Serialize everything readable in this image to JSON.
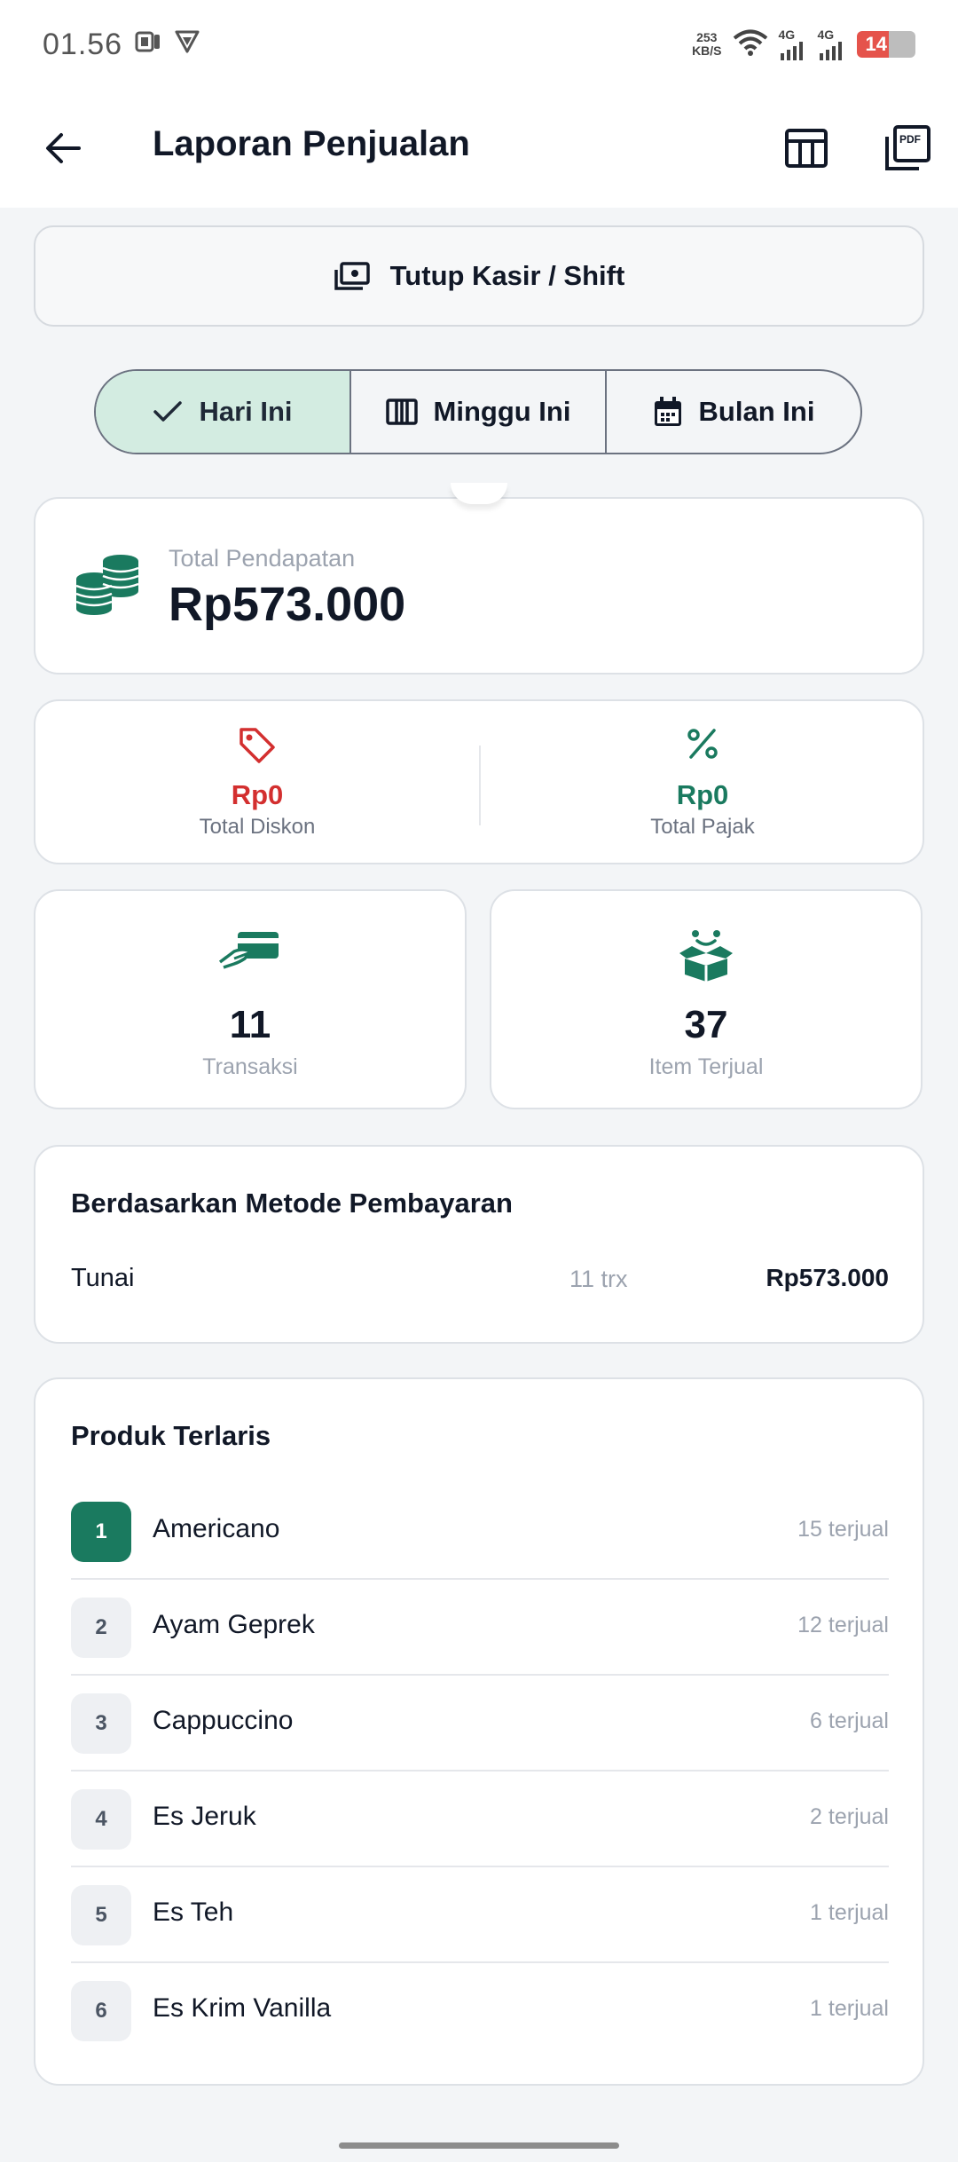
{
  "status_bar": {
    "time": "01.56",
    "speed_value": "253",
    "speed_unit": "KB/S",
    "net1": "4G",
    "net2": "4G",
    "battery": "14"
  },
  "app_bar": {
    "title": "Laporan Penjualan",
    "back_icon": "arrow-left-icon",
    "table_icon": "table-view-icon",
    "pdf_icon": "pdf-export-icon",
    "pdf_text": "PDF"
  },
  "shift_button": {
    "label": "Tutup Kasir / Shift",
    "icon": "cash-register-icon"
  },
  "period_tabs": [
    {
      "label": "Hari Ini",
      "icon": "check-icon",
      "active": true
    },
    {
      "label": "Minggu Ini",
      "icon": "week-columns-icon",
      "active": false
    },
    {
      "label": "Bulan Ini",
      "icon": "calendar-icon",
      "active": false
    }
  ],
  "total_revenue": {
    "label": "Total Pendapatan",
    "value": "Rp573.000",
    "icon": "coins-icon"
  },
  "discount": {
    "value": "Rp0",
    "label": "Total Diskon",
    "icon": "tag-icon",
    "color": "#d32f2f"
  },
  "tax": {
    "value": "Rp0",
    "label": "Total Pajak",
    "icon": "percent-icon",
    "color": "#1a7a5f"
  },
  "transactions": {
    "value": "11",
    "label": "Transaksi",
    "icon": "card-payment-icon"
  },
  "items_sold": {
    "value": "37",
    "label": "Item Terjual",
    "icon": "open-box-icon"
  },
  "payment_methods": {
    "title": "Berdasarkan Metode Pembayaran",
    "rows": [
      {
        "method": "Tunai",
        "count": "11 trx",
        "amount": "Rp573.000"
      }
    ]
  },
  "top_products": {
    "title": "Produk Terlaris",
    "rows": [
      {
        "rank": "1",
        "name": "Americano",
        "sold": "15 terjual"
      },
      {
        "rank": "2",
        "name": "Ayam Geprek",
        "sold": "12 terjual"
      },
      {
        "rank": "3",
        "name": "Cappuccino",
        "sold": "6 terjual"
      },
      {
        "rank": "4",
        "name": "Es Jeruk",
        "sold": "2 terjual"
      },
      {
        "rank": "5",
        "name": "Es Teh",
        "sold": "1 terjual"
      },
      {
        "rank": "6",
        "name": "Es Krim Vanilla",
        "sold": "1 terjual"
      }
    ]
  },
  "colors": {
    "accent": "#1a7a5f",
    "active_tab_bg": "#d3ece1",
    "danger": "#d32f2f"
  }
}
